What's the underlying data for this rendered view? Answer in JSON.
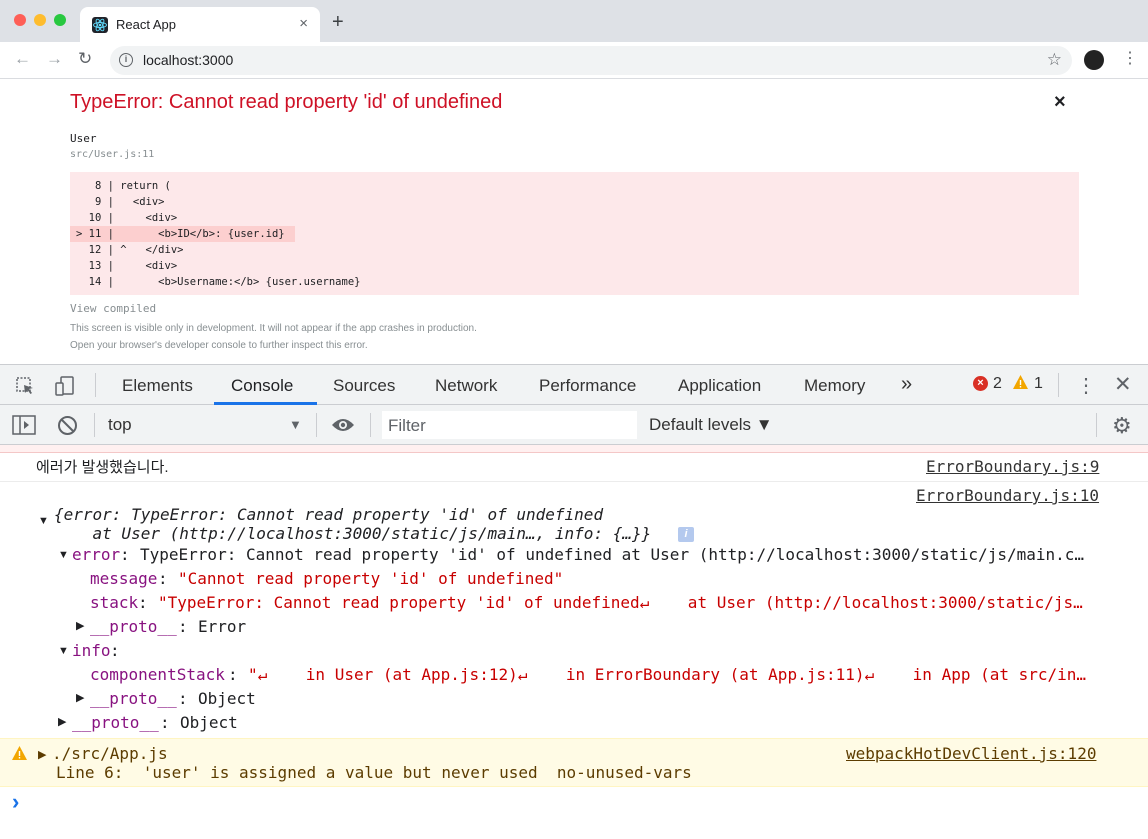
{
  "browser": {
    "tab_title": "React App",
    "tab_close": "×",
    "new_tab": "+",
    "url": "localhost:3000"
  },
  "overlay": {
    "title": "TypeError: Cannot read property 'id' of undefined",
    "close": "×",
    "file_name": "User",
    "file_location": "src/User.js:11",
    "code_lines": [
      "   8 | return (",
      "   9 |   <div>",
      "  10 |     <div>",
      "> 11 |       <b>ID</b>: {user.id}",
      "  12 | ^   </div>",
      "  13 |     <div>",
      "  14 |       <b>Username:</b> {user.username}"
    ],
    "view_compiled": "View compiled",
    "footer_line1": "This screen is visible only in development. It will not appear if the app crashes in production.",
    "footer_line2": "Open your browser's developer console to further inspect this error."
  },
  "devtools": {
    "tabs": [
      "Elements",
      "Console",
      "Sources",
      "Network",
      "Performance",
      "Application",
      "Memory"
    ],
    "more_tabs": "»",
    "error_count": "2",
    "warning_count": "1",
    "context": "top",
    "filter_placeholder": "Filter",
    "levels": "Default levels ▼"
  },
  "console": {
    "msg1_text": "에러가 발생했습니다.",
    "msg1_source": "ErrorBoundary.js:9",
    "msg2_source": "ErrorBoundary.js:10",
    "obj_line1": "{error: TypeError: Cannot read property 'id' of undefined",
    "obj_line2": "    at User (http://localhost:3000/static/js/main…, info: {…}}",
    "info_badge": "i",
    "error_key": "error",
    "error_value": "TypeError: Cannot read property 'id' of undefined at User (http://localhost:3000/static/js/main.c…",
    "message_key": "message",
    "message_value": "\"Cannot read property 'id' of undefined\"",
    "stack_key": "stack",
    "stack_value": "\"TypeError: Cannot read property 'id' of undefined↵    at User (http://localhost:3000/static/js…",
    "proto_key": "__proto__",
    "proto_error": "Error",
    "info_key": "info",
    "component_stack_key": "componentStack",
    "component_stack_value": "\"↵    in User (at App.js:12)↵    in ErrorBoundary (at App.js:11)↵    in App (at src/in…",
    "proto_object": "Object",
    "warn_file": "./src/App.js",
    "warn_source": "webpackHotDevClient.js:120",
    "warn_detail": "Line 6:  'user' is assigned a value but never used  no-unused-vars",
    "prompt": "›"
  },
  "colors": {
    "error_red": "#ce1126",
    "code_bg": "#fde8ea",
    "warning_bg": "#fffbe5",
    "accent_blue": "#1a73e8"
  }
}
